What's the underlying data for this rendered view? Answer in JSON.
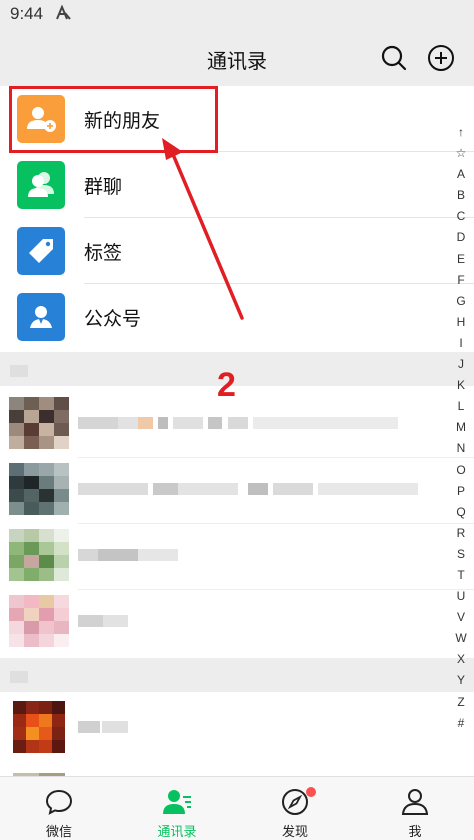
{
  "status": {
    "time": "9:44",
    "icon": "app-notification-icon"
  },
  "header": {
    "title": "通讯录",
    "search_icon": "search-icon",
    "add_icon": "plus-circle-icon"
  },
  "menu": [
    {
      "label": "新的朋友",
      "icon": "add-friend-icon",
      "color": "#fa9d3b"
    },
    {
      "label": "群聊",
      "icon": "group-chat-icon",
      "color": "#07c160"
    },
    {
      "label": "标签",
      "icon": "tag-icon",
      "color": "#2782d7"
    },
    {
      "label": "公众号",
      "icon": "official-account-icon",
      "color": "#2782d7"
    }
  ],
  "index": [
    "↑",
    "☆",
    "A",
    "B",
    "C",
    "D",
    "E",
    "F",
    "G",
    "H",
    "I",
    "J",
    "K",
    "L",
    "M",
    "N",
    "O",
    "P",
    "Q",
    "R",
    "S",
    "T",
    "U",
    "V",
    "W",
    "X",
    "Y",
    "Z",
    "#"
  ],
  "annotation": {
    "step": "2",
    "color": "#e01e24"
  },
  "tabs": [
    {
      "label": "微信",
      "icon": "chat-bubble-icon",
      "active": false
    },
    {
      "label": "通讯录",
      "icon": "contacts-icon",
      "active": true
    },
    {
      "label": "发现",
      "icon": "compass-icon",
      "active": false,
      "badge": true
    },
    {
      "label": "我",
      "icon": "person-icon",
      "active": false
    }
  ],
  "colors": {
    "accent": "#07c160",
    "highlight": "#e01e24",
    "badge": "#fa5151"
  }
}
